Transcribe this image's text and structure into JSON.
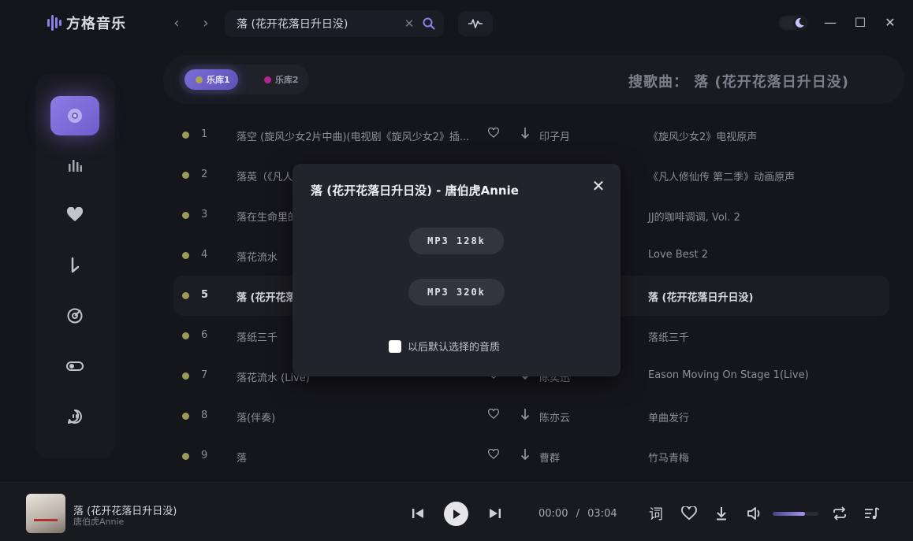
{
  "app": {
    "name": "方格音乐"
  },
  "search": {
    "query": "落 (花开花落日升日没)"
  },
  "colors": {
    "accent": "#8d7ce6",
    "lib1_dot": "#a9a652",
    "lib2_dot": "#b0268e",
    "row_dot": "#9d9a5a"
  },
  "sidebar": {
    "items": [
      {
        "icon": "disc-icon",
        "active": true
      },
      {
        "icon": "chart-bars-icon"
      },
      {
        "icon": "heart-icon"
      },
      {
        "icon": "download-arrow-icon"
      },
      {
        "icon": "radar-icon"
      },
      {
        "icon": "toggle-icon"
      },
      {
        "icon": "chat-face-icon"
      }
    ]
  },
  "libraries": [
    {
      "label": "乐库1",
      "active": true
    },
    {
      "label": "乐库2",
      "active": false
    }
  ],
  "header": {
    "title": "搜歌曲：  落 (花开花落日升日没)"
  },
  "songs": [
    {
      "num": "1",
      "title": "落空 (旋风少女2片中曲)(电视剧《旋风少女2》插...",
      "artist": "印子月",
      "album": "《旋风少女2》电视原声"
    },
    {
      "num": "2",
      "title": "落英（《凡人",
      "artist": "",
      "album": "《凡人修仙传 第二季》动画原声"
    },
    {
      "num": "3",
      "title": "落在生命里的",
      "artist": "",
      "album": "JJ的咖啡调调, Vol. 2"
    },
    {
      "num": "4",
      "title": "落花流水",
      "artist": "",
      "album": "Love Best 2"
    },
    {
      "num": "5",
      "title": "落 (花开花落",
      "artist": "",
      "album": "落 (花开花落日升日没)",
      "selected": true
    },
    {
      "num": "6",
      "title": "落纸三千",
      "artist": "",
      "album": "落纸三千"
    },
    {
      "num": "7",
      "title": "落花流水 (Live)",
      "artist": "陈奕迅",
      "album": "Eason Moving On Stage 1(Live)"
    },
    {
      "num": "8",
      "title": "落(伴奏)",
      "artist": "陈亦云",
      "album": "单曲发行"
    },
    {
      "num": "9",
      "title": "落",
      "artist": "曹群",
      "album": "竹马青梅"
    }
  ],
  "modal": {
    "title": "落 (花开花落日升日没) - 唐伯虎Annie",
    "option1": "MP3 128k",
    "option2": "MP3 320k",
    "remember_label": "以后默认选择的音质"
  },
  "player": {
    "song_title": "落 (花开花落日升日没)",
    "artist": "唐伯虎Annie",
    "current_time": "00:00",
    "separator": "/",
    "duration": "03:04",
    "lyrics_label": "词",
    "volume": 0.7
  }
}
